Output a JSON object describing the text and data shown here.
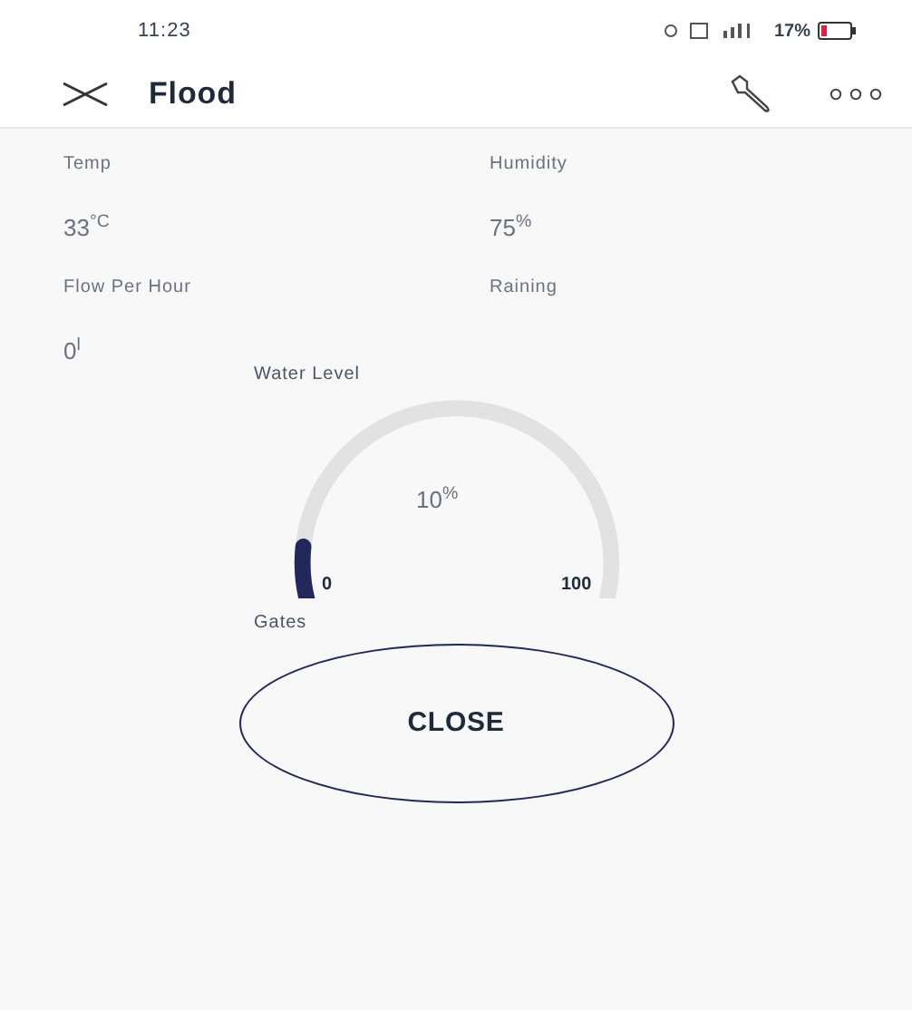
{
  "status_bar": {
    "time": "11:23",
    "battery": "17%"
  },
  "header": {
    "title": "Flood"
  },
  "readings": [
    {
      "label": "Temp",
      "value": "33$^{°C}$"
    },
    {
      "label": "Humidity",
      "value": "75$^{%}$"
    },
    {
      "label": "Flow Per Hour",
      "value": "0$^{l}$"
    },
    {
      "label": "Raining"
    }
  ],
  "gauge": {
    "label": "Water Level",
    "value": "10$^{%}$",
    "level": 0.1,
    "min": "0",
    "max": "100"
  },
  "gates": {
    "label": "Gates",
    "button": "CLOSE"
  }
}
